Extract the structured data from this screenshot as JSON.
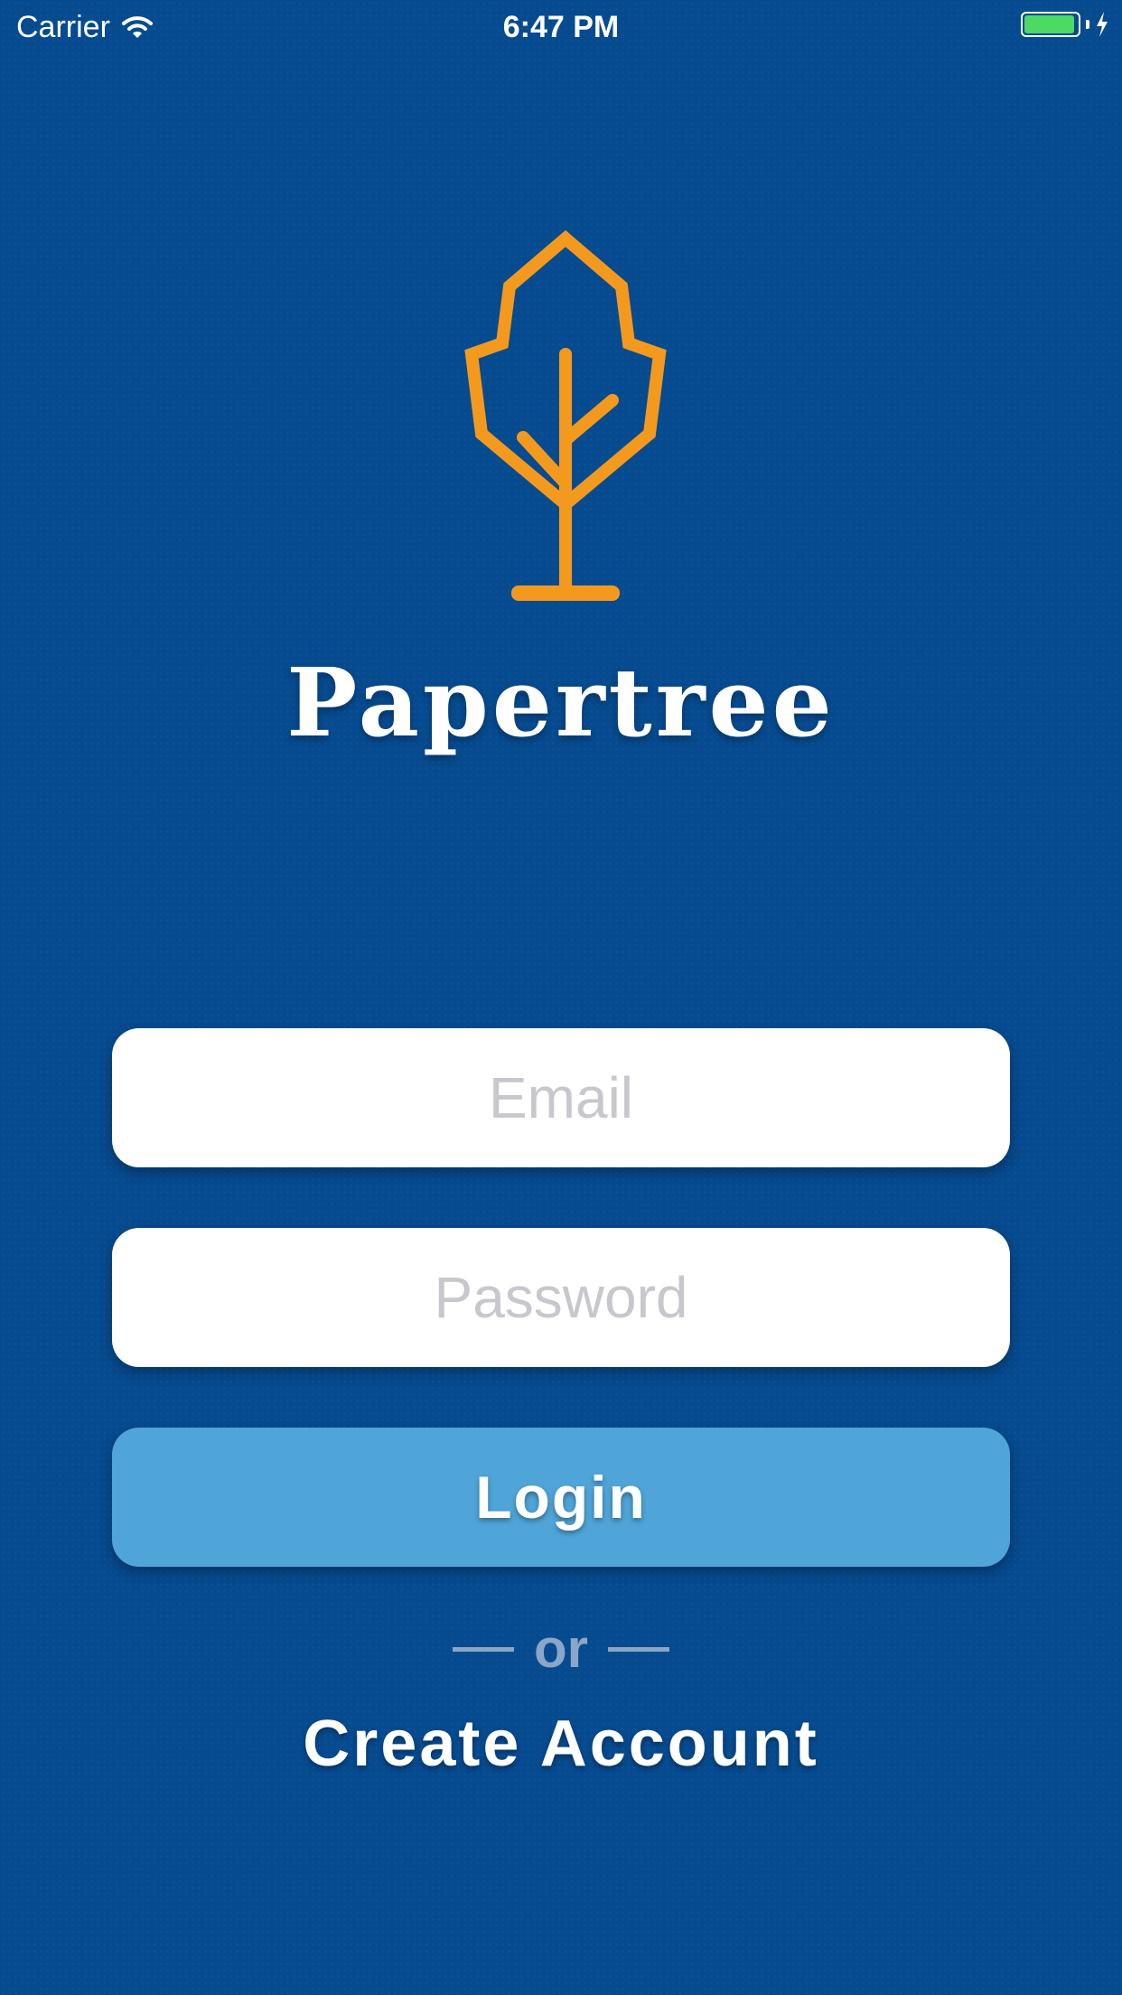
{
  "status_bar": {
    "carrier": "Carrier",
    "time": "6:47 PM",
    "battery_level": 0.95,
    "battery_color": "#4cd964",
    "icons": [
      "wifi-icon",
      "battery-icon",
      "charging-bolt-icon"
    ]
  },
  "brand": {
    "app_name": "Papertree",
    "logo_icon": "tree-logo-icon",
    "logo_color": "#f39a1e"
  },
  "login_form": {
    "email_placeholder": "Email",
    "email_value": "",
    "password_placeholder": "Password",
    "password_value": "",
    "login_label": "Login",
    "divider_text": "or",
    "create_account_label": "Create Account"
  },
  "colors": {
    "background": "#064a8f",
    "login_button": "#4fa5d8",
    "divider": "#8ba6c6",
    "placeholder": "#c7c7cd"
  }
}
